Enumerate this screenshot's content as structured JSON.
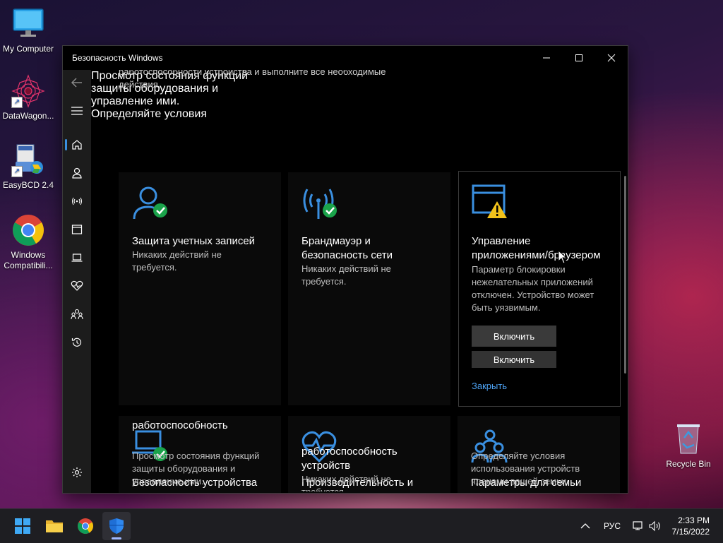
{
  "desktop": {
    "icons": [
      {
        "label": "My Computer",
        "icon": "monitor-icon"
      },
      {
        "label": "DataWagon...",
        "icon": "datawagon-icon"
      },
      {
        "label": "EasyBCD 2.4",
        "icon": "easybcd-icon"
      },
      {
        "label": "Windows Compatibili...",
        "icon": "chrome-icon"
      },
      {
        "label": "Recycle Bin",
        "icon": "recycle-bin-icon"
      }
    ]
  },
  "window": {
    "title": "Безопасность Windows",
    "controls": {
      "minimize": "minimize-icon",
      "maximize": "maximize-icon",
      "close": "close-icon"
    }
  },
  "nav": {
    "items": [
      "back-arrow-icon",
      "hamburger-menu-icon",
      "home-icon",
      "account-icon",
      "antenna-icon",
      "app-browser-icon",
      "laptop-icon",
      "heart-pulse-icon",
      "family-icon",
      "history-icon",
      "settings-icon"
    ]
  },
  "content": {
    "intro_line1": "работоспособности устройства и выполните все необходимые",
    "intro_line2": "действия.",
    "cards": {
      "account": {
        "title": "Защита учетных записей",
        "desc1": "Никаких действий не",
        "desc2": "требуется."
      },
      "firewall": {
        "title1": "Брандмауэр и",
        "title2": "безопасность сети",
        "desc1": "Никаких действий не",
        "desc2": "требуется."
      },
      "appbrowser": {
        "title1": "Управление",
        "title2": "приложениями/браузером",
        "desc1": "Параметр блокировки",
        "desc2": "нежелательных приложений",
        "desc3": "отключен. Устройство может",
        "desc4": "быть уязвимым.",
        "button": "Включить",
        "button_ghost": "Включить",
        "link": "Закрыть"
      },
      "device": {
        "title": "Безопасность устройства",
        "desc1": "Просмотр состояния функций",
        "desc2": "защиты оборудования и",
        "desc3": "управление ими."
      },
      "performance": {
        "title1": "Производительность и",
        "title2": "работоспособность",
        "title3": "устройств",
        "desc1": "Никаких действий не",
        "desc2": "требуется."
      },
      "family": {
        "title": "Параметры для семьи",
        "desc1": "Определяйте условия",
        "desc2": "использования устройств",
        "desc3": "членами вашей семьи."
      }
    }
  },
  "taskbar": {
    "language": "РУС",
    "time": "2:33 PM",
    "date": "7/15/2022"
  },
  "colors": {
    "accent": "#3a8fe0",
    "ok": "#1aa34a",
    "warn": "#f2c21b"
  }
}
